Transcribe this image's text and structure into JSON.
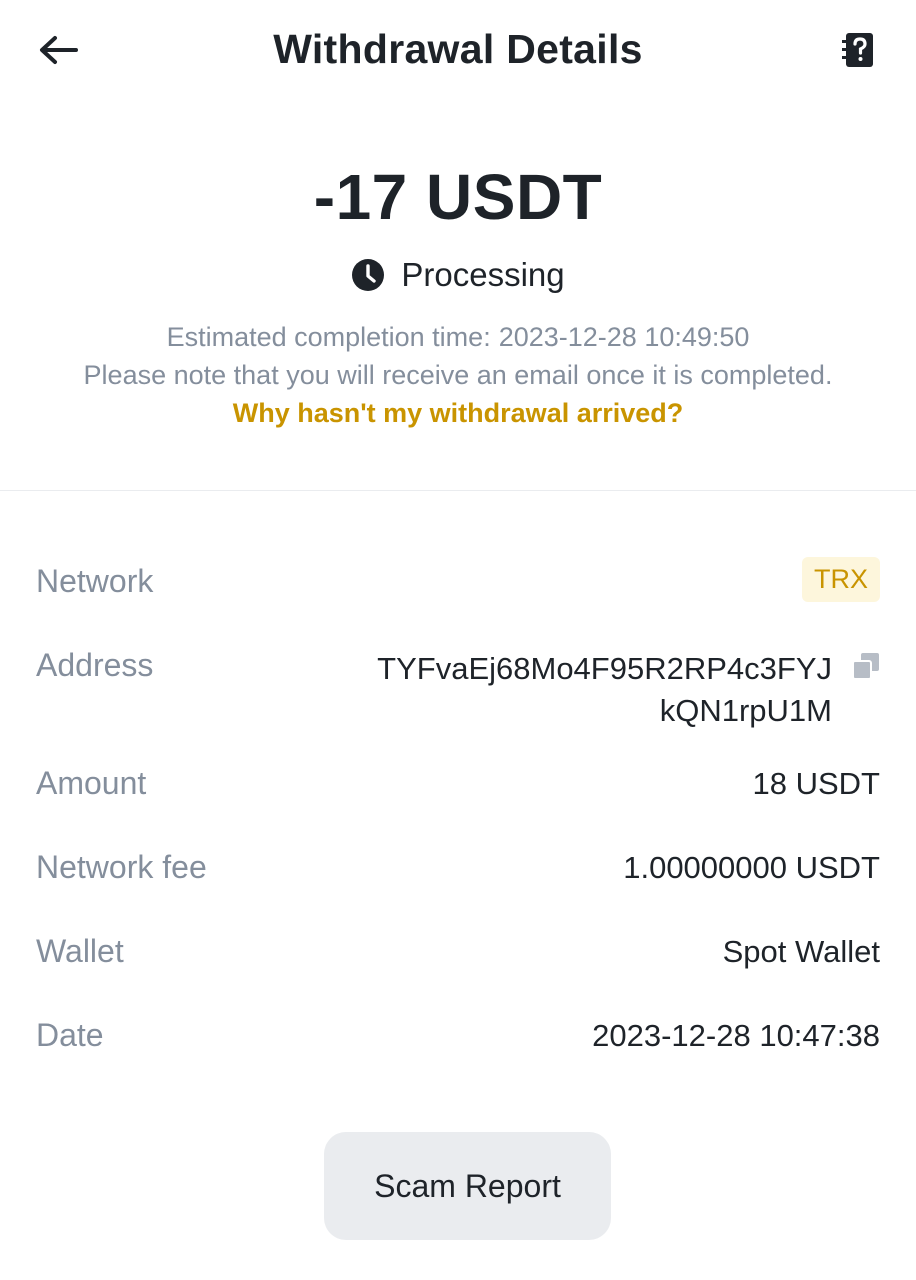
{
  "header": {
    "title": "Withdrawal Details",
    "back_icon": "arrow-left-icon",
    "help_icon": "help-document-icon"
  },
  "summary": {
    "amount": "-17 USDT",
    "status_icon": "clock-icon",
    "status": "Processing",
    "estimated_label": "Estimated completion time:",
    "estimated_time": "2023-12-28 10:49:50",
    "note": "Please note that you will receive an email once it is completed.",
    "help_link": "Why hasn't my withdrawal arrived?"
  },
  "details": {
    "network_label": "Network",
    "network_value": "TRX",
    "address_label": "Address",
    "address_line1": "TYFvaEj68Mo4F95R2RP4c3FYJ",
    "address_line2": "kQN1rpU1M",
    "copy_icon": "copy-icon",
    "amount_label": "Amount",
    "amount_value": "18 USDT",
    "fee_label": "Network fee",
    "fee_value": "1.00000000 USDT",
    "wallet_label": "Wallet",
    "wallet_value": "Spot Wallet",
    "date_label": "Date",
    "date_value": "2023-12-28 10:47:38"
  },
  "actions": {
    "scam_report_label": "Scam Report"
  },
  "colors": {
    "text_primary": "#1e2329",
    "text_secondary": "#848e9c",
    "accent": "#c99400",
    "badge_bg": "#fdf6dc",
    "button_bg": "#eaecef"
  }
}
